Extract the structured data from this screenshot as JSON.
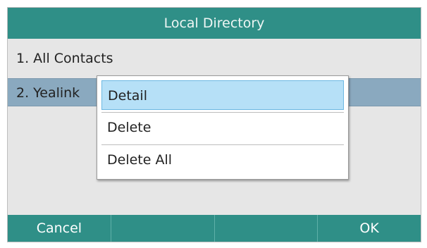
{
  "header": {
    "title": "Local Directory"
  },
  "list": {
    "items": [
      {
        "label": "1. All Contacts"
      },
      {
        "label": "2. Yealink"
      }
    ]
  },
  "popup_menu": {
    "items": [
      {
        "label": "Detail",
        "selected": true
      },
      {
        "label": "Delete",
        "selected": false
      },
      {
        "label": "Delete All",
        "selected": false
      }
    ]
  },
  "softkeys": [
    {
      "label": "Cancel"
    },
    {
      "label": ""
    },
    {
      "label": ""
    },
    {
      "label": "OK"
    }
  ],
  "colors": {
    "accent": "#2f8f87",
    "selected_row": "#8aa9bf",
    "menu_highlight": "#b6e0f7"
  }
}
